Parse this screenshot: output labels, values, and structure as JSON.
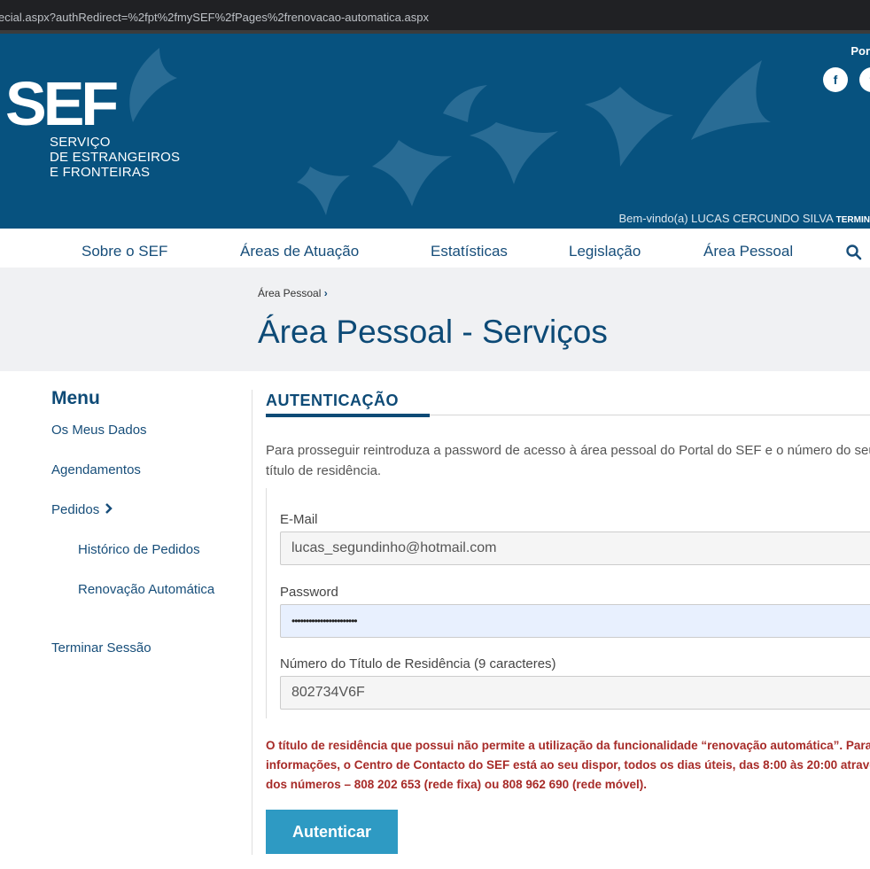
{
  "browser": {
    "url": "ecial.aspx?authRedirect=%2fpt%2fmySEF%2fPages%2frenovacao-automatica.aspx"
  },
  "header": {
    "logo_text": "SEF",
    "logo_sub_1": "SERVIÇO",
    "logo_sub_2": "DE ESTRANGEIROS",
    "logo_sub_3": "E FRONTEIRAS",
    "lang": "Por",
    "welcome": "Bem-vindo(a) LUCAS CERCUNDO SILVA",
    "logout_short": "TERMIN",
    "social": [
      "facebook-icon",
      "twitter-icon"
    ]
  },
  "nav": {
    "items": [
      "Sobre o SEF",
      "Áreas de Atuação",
      "Estatísticas",
      "Legislação",
      "Área Pessoal"
    ]
  },
  "page": {
    "breadcrumb": "Área Pessoal",
    "title": "Área Pessoal - Serviços"
  },
  "menu": {
    "heading": "Menu",
    "items": [
      "Os Meus Dados",
      "Agendamentos",
      "Pedidos",
      "Histórico de Pedidos",
      "Renovação Automática",
      "Terminar Sessão"
    ]
  },
  "auth": {
    "section_title": "AUTENTICAÇÃO",
    "intro": "Para prosseguir reintroduza a password de acesso à área pessoal do Portal do SEF e o número do seu título de residência.",
    "email_label": "E-Mail",
    "email_value": "lucas_segundinho@hotmail.com",
    "password_label": "Password",
    "password_value": "•••••••••••••••••••••••",
    "residence_label": "Número do Título de Residência (9 caracteres)",
    "residence_value": "802734V6F",
    "warning": "O título de residência que possui não permite a utilização da funcionalidade “renovação automática”. Para mais informações, o Centro de Contacto do SEF está ao seu dispor, todos os dias úteis, das 8:00 às 20:00 através dos números – 808 202 653 (rede fixa) ou 808 962 690 (rede móvel).",
    "submit": "Autenticar"
  },
  "colors": {
    "brand_blue": "#07527f",
    "nav_text": "#174e7a",
    "button": "#2e9ac3",
    "warning": "#a72b28"
  }
}
